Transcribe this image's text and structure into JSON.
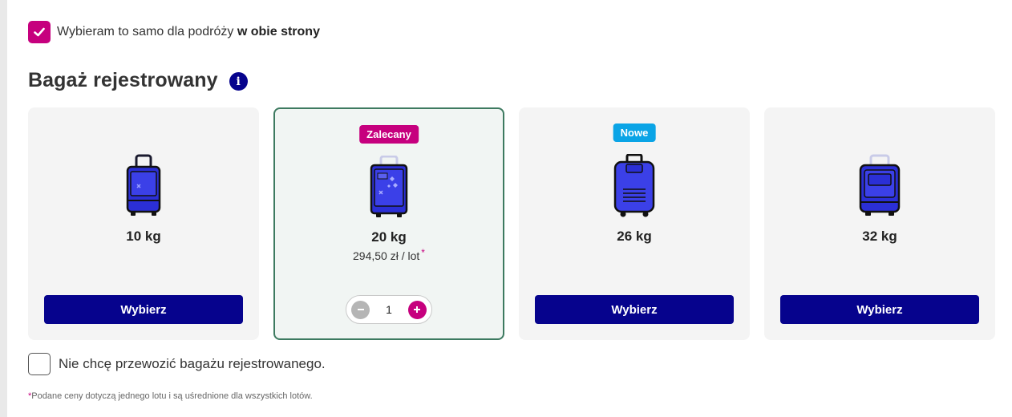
{
  "same_both": {
    "checked": true,
    "text_prefix": "Wybieram to samo dla podróży",
    "text_bold": "w obie strony"
  },
  "section": {
    "title": "Bagaż rejestrowany",
    "info_icon": "info-icon"
  },
  "cards": [
    {
      "weight": "10 kg",
      "button_label": "Wybierz",
      "icon": "suitcase-10kg-icon"
    },
    {
      "weight": "20 kg",
      "badge": "Zalecany",
      "price": "294,50 zł / lot",
      "price_marker": "*",
      "selected": true,
      "quantity": "1",
      "icon": "suitcase-20kg-icon"
    },
    {
      "weight": "26 kg",
      "badge": "Nowe",
      "button_label": "Wybierz",
      "icon": "suitcase-26kg-icon"
    },
    {
      "weight": "32 kg",
      "button_label": "Wybierz",
      "icon": "suitcase-32kg-icon"
    }
  ],
  "no_bag": {
    "checked": false,
    "label": "Nie chcę przewozić bagażu rejestrowanego."
  },
  "footnote": {
    "marker": "*",
    "text": "Podane ceny dotyczą jednego lotu i są uśrednione dla wszystkich lotów."
  },
  "colors": {
    "primary": "#06038d",
    "accent_pink": "#c6007e",
    "accent_blue": "#0aa4e6",
    "selected_border": "#3d7a60"
  }
}
